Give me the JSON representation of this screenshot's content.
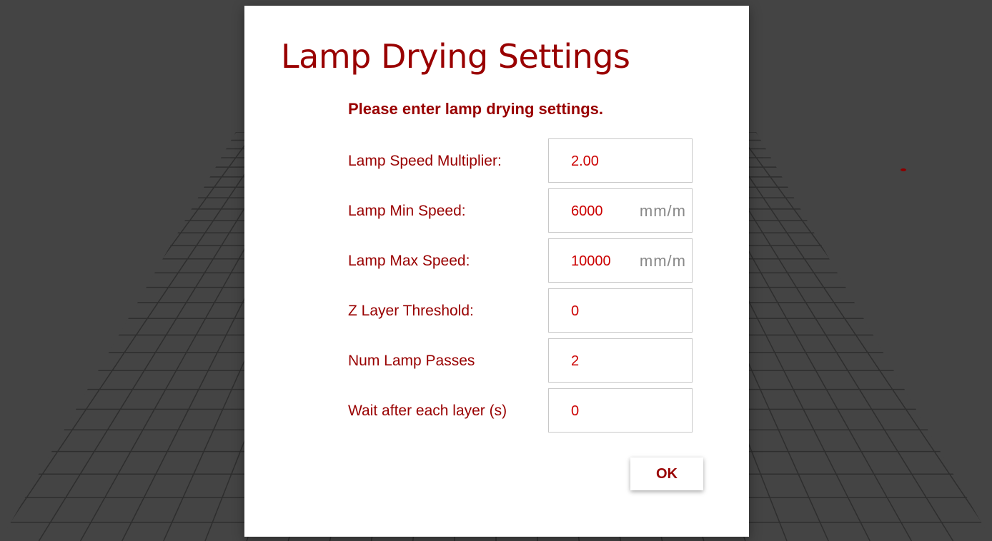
{
  "dialog": {
    "title": "Lamp Drying Settings",
    "subtitle": "Please enter lamp drying settings.",
    "fields": [
      {
        "label": "Lamp Speed Multiplier:",
        "value": "2.00",
        "unit": ""
      },
      {
        "label": "Lamp Min Speed:",
        "value": "6000",
        "unit": "mm/m"
      },
      {
        "label": "Lamp Max Speed:",
        "value": "10000",
        "unit": "mm/m"
      },
      {
        "label": "Z Layer Threshold:",
        "value": "0",
        "unit": ""
      },
      {
        "label": "Num Lamp Passes",
        "value": "2",
        "unit": ""
      },
      {
        "label": "Wait after each layer (s)",
        "value": "0",
        "unit": ""
      }
    ],
    "ok_label": "OK"
  },
  "colors": {
    "accent": "#990000",
    "value_text": "#cc0000",
    "unit_text": "#888888",
    "backdrop": "#444444",
    "grid_line": "#2e2e2e"
  },
  "icons": {
    "bed_grid": "print-bed-grid"
  }
}
